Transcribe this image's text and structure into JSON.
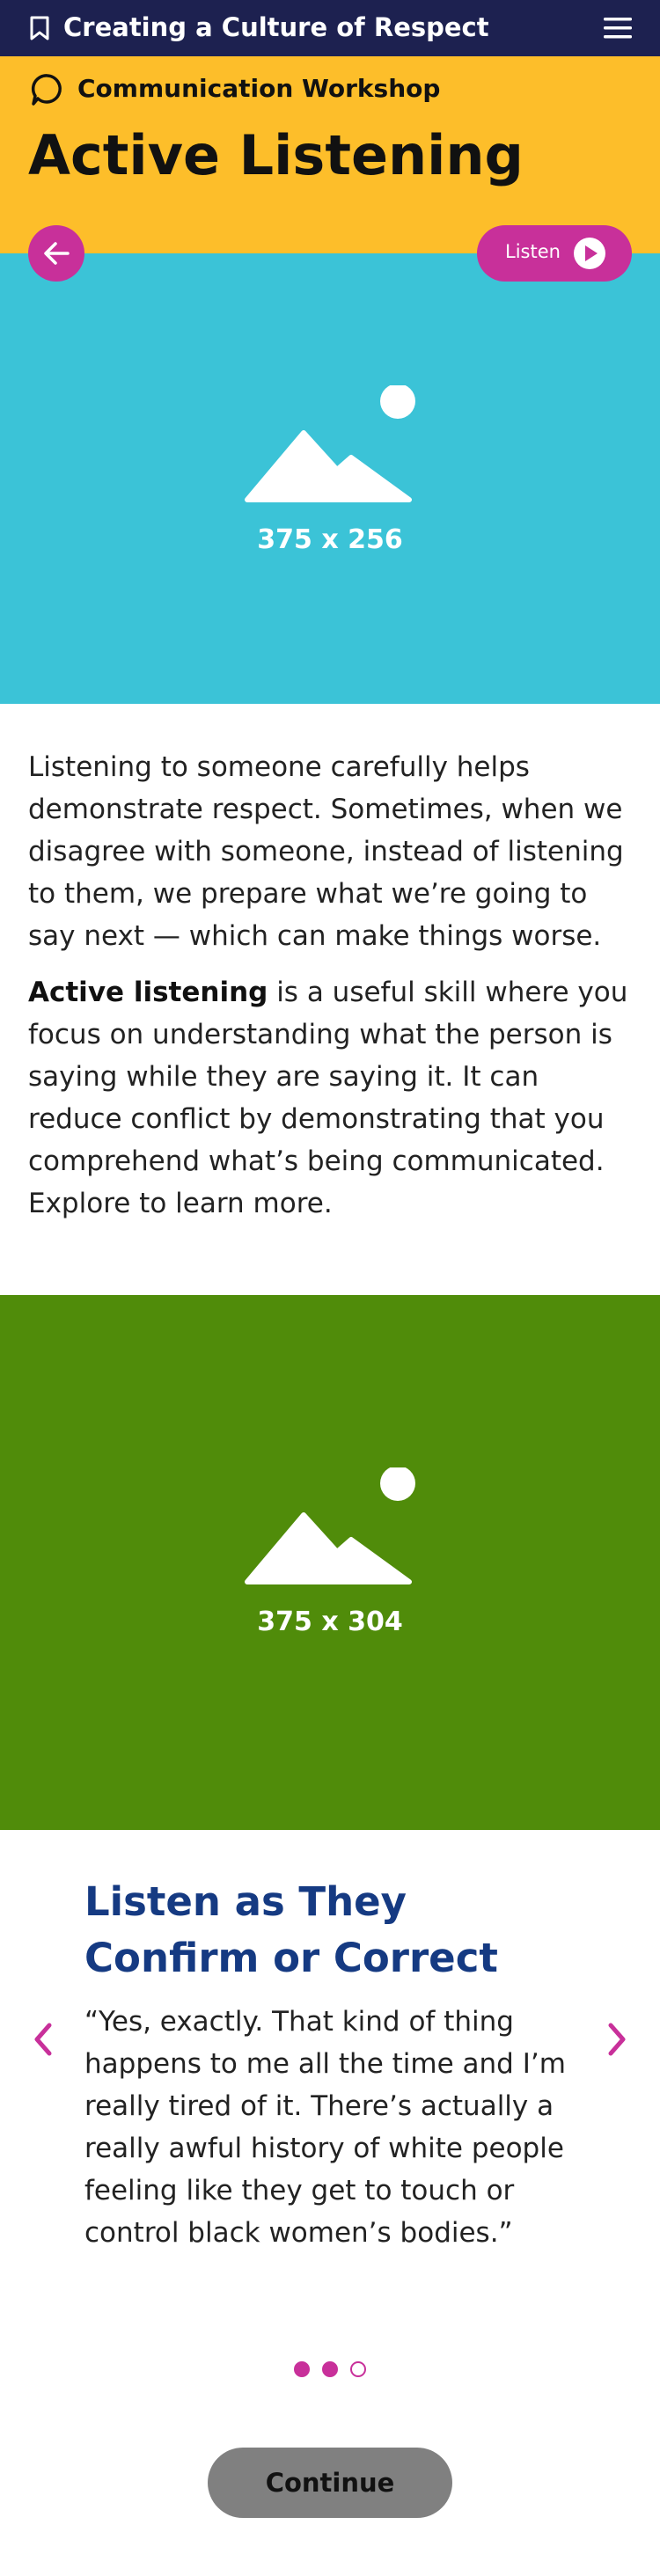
{
  "app_bar": {
    "title": "Creating a Culture of Respect",
    "bookmark_icon": "bookmark-icon",
    "menu_icon": "hamburger-menu-icon"
  },
  "header": {
    "workshop_label": "Communication Workshop",
    "workshop_icon": "speech-bubble-icon",
    "page_title": "Active Listening"
  },
  "controls": {
    "back_icon": "arrow-left-icon",
    "listen_label": "Listen",
    "listen_icon": "play-icon"
  },
  "images": [
    {
      "label": "375 x 256",
      "color": "#3bc3d7"
    },
    {
      "label": "375 x 304",
      "color": "#508c0a"
    }
  ],
  "intro": {
    "p1": "Listening to someone carefully helps demonstrate respect. Sometimes, when we disagree with someone, instead of listening to them, we prepare what we’re going to say next — which can make things worse.",
    "p2_bold": "Active listening",
    "p2_rest": " is a useful skill where you focus on understanding what the person is saying while they are saying it. It can reduce conflict by demonstrating that you comprehend what’s being communicated. Explore to learn more."
  },
  "carousel": {
    "title": "Listen as They Confirm or Correct",
    "quote": "“Yes, exactly. That kind of thing happens to me all the time and I’m really tired of it. There’s actually a really awful history of white people feeling like they get to touch or control black women’s bodies.”",
    "slide_count": 3,
    "active_slides": [
      1,
      2
    ],
    "prev_icon": "chevron-left-icon",
    "next_icon": "chevron-right-icon"
  },
  "footer": {
    "continue_label": "Continue"
  },
  "colors": {
    "navy": "#1d2150",
    "yellow": "#fdbe2a",
    "magenta": "#c8309a",
    "title_blue": "#153a82",
    "button_gray": "#808080"
  }
}
